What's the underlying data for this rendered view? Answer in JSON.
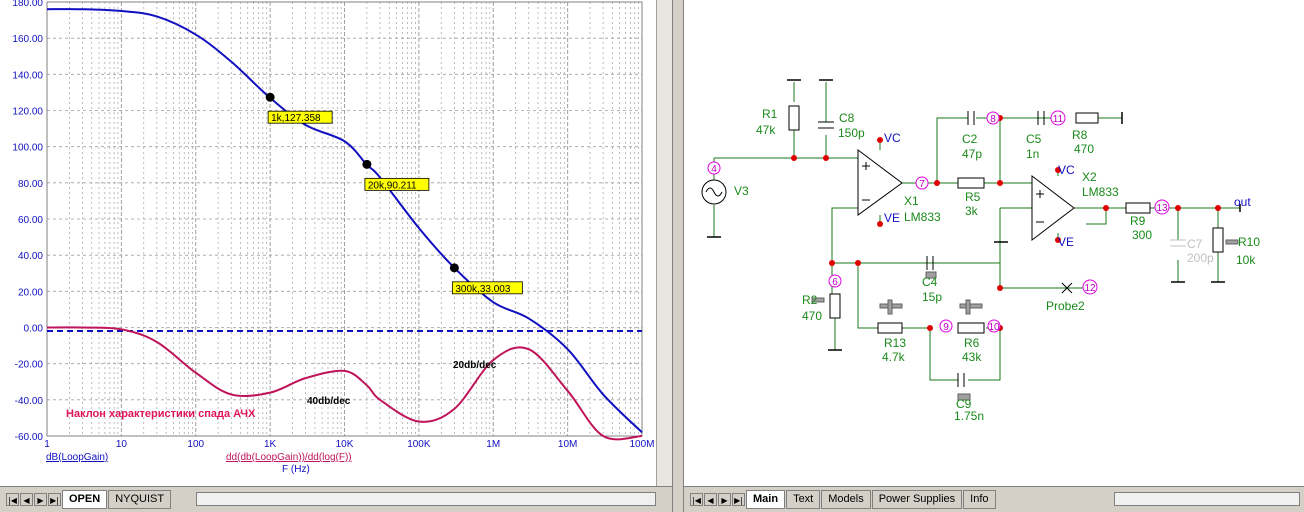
{
  "plot": {
    "y_ticks": [
      "180.00",
      "160.00",
      "140.00",
      "120.00",
      "100.00",
      "80.00",
      "60.00",
      "40.00",
      "20.00",
      "0.00",
      "-20.00",
      "-40.00",
      "-60.00"
    ],
    "x_ticks": [
      "1",
      "10",
      "100",
      "1K",
      "10K",
      "100K",
      "1M",
      "10M",
      "100M"
    ],
    "markers": [
      "1k,127.358",
      "20k,90.211",
      "300k,33.003"
    ],
    "annotations": {
      "slope20": "20db/dec",
      "slope40": "40db/dec",
      "title": "Наклон характеристики спада АЧХ"
    },
    "legend": {
      "trace1": "dB(LoopGain)",
      "trace2": "dd(db(LoopGain))/dd(log(F))",
      "xaxis": "F (Hz)"
    },
    "tabs": [
      "OPEN",
      "NYQUIST"
    ],
    "colors": {
      "trace1": "#1010c0",
      "trace2": "#c0145a",
      "grid": "#a0a0a0",
      "marker": "#ffff00"
    }
  },
  "chart_data": {
    "type": "line",
    "x_scale": "log",
    "x": [
      1,
      3,
      10,
      30,
      100,
      300,
      1000,
      3000,
      10000,
      20000,
      30000,
      100000,
      300000,
      1000000,
      3000000,
      10000000,
      30000000,
      100000000
    ],
    "series": [
      {
        "name": "dB(LoopGain)",
        "values": [
          176,
          176,
          175,
          172,
          162,
          147,
          127,
          112,
          103,
          90,
          83,
          55,
          33,
          14,
          5,
          -12,
          -37,
          -58
        ]
      },
      {
        "name": "dd(db(LoopGain))/dd(log(F))",
        "values": [
          0,
          0,
          -1,
          -8,
          -25,
          -37,
          -36,
          -28,
          -24,
          -32,
          -40,
          -52,
          -45,
          -18,
          -12,
          -35,
          -60,
          -60
        ]
      }
    ],
    "ylim": [
      -60,
      180
    ],
    "xlim": [
      1,
      100000000
    ],
    "grid": true
  },
  "schematic": {
    "labels": {
      "r1": "R1",
      "r1v": "47k",
      "c8": "C8",
      "c8v": "150p",
      "v3": "V3",
      "vc1": "VC",
      "ve1": "VE",
      "x1": "X1",
      "x1m": "LM833",
      "c2": "C2",
      "c2v": "47p",
      "c5": "C5",
      "c5v": "1n",
      "r8": "R8",
      "r8v": "470",
      "r5": "R5",
      "r5v": "3k",
      "vc2": "VC",
      "x2": "X2",
      "x2m": "LM833",
      "ve2": "VE",
      "r9": "R9",
      "r9v": "300",
      "c7": "C7",
      "c7v": "200p",
      "r10": "R10",
      "r10v": "10k",
      "out": "out",
      "r2": "R2",
      "r2v": "470",
      "c4": "C4",
      "c4v": "15p",
      "probe": "Probe2",
      "r13": "R13",
      "r13v": "4.7k",
      "r6": "R6",
      "r6v": "43k",
      "c9": "C9",
      "c9v": "1.75n"
    },
    "nodes": {
      "n4": "4",
      "n6": "6",
      "n7": "7",
      "n8": "8",
      "n9": "9",
      "n10": "10",
      "n11": "11",
      "n12": "12",
      "n13": "13"
    },
    "tabs": [
      "Main",
      "Text",
      "Models",
      "Power Supplies",
      "Info"
    ]
  }
}
